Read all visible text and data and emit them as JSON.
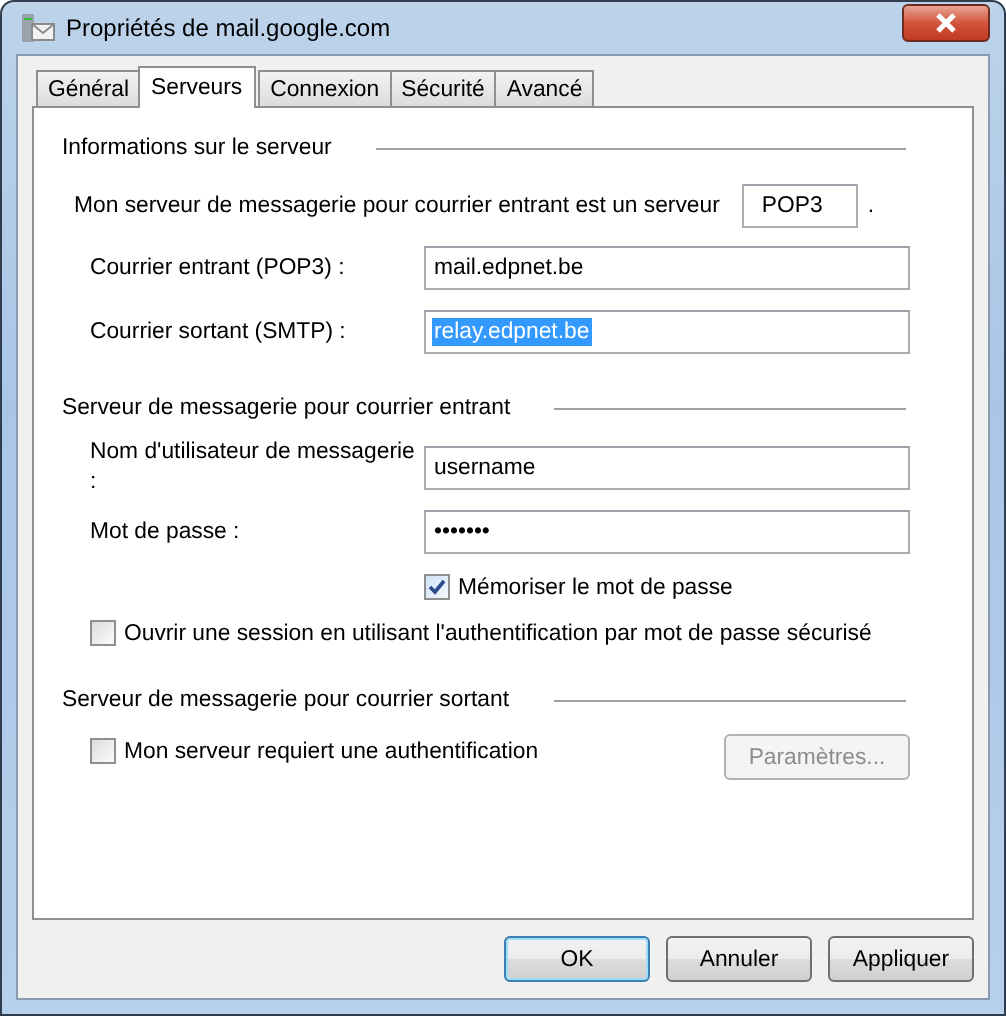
{
  "window": {
    "title": "Propriétés de mail.google.com"
  },
  "tabs": [
    {
      "label": "Général",
      "selected": false
    },
    {
      "label": "Serveurs",
      "selected": true
    },
    {
      "label": "Connexion",
      "selected": false
    },
    {
      "label": "Sécurité",
      "selected": false
    },
    {
      "label": "Avancé",
      "selected": false
    }
  ],
  "sections": [
    {
      "heading": "Informations sur le serveur",
      "rows": [
        {
          "kind": "inline",
          "label": "Mon serveur de messagerie pour courrier entrant est un serveur",
          "value": "POP3",
          "suffix": "."
        },
        {
          "kind": "field",
          "label": "Courrier entrant (POP3) :",
          "value": "mail.edpnet.be",
          "highlighted": false
        },
        {
          "kind": "field",
          "label": "Courrier sortant (SMTP) :",
          "value": "relay.edpnet.be",
          "highlighted": true
        }
      ]
    },
    {
      "heading": "Serveur de messagerie pour courrier entrant",
      "rows": [
        {
          "kind": "field",
          "label": "Nom d'utilisateur de messagerie :",
          "value": "username",
          "highlighted": false
        },
        {
          "kind": "password",
          "label": "Mot de passe :",
          "value": "•••••••"
        },
        {
          "kind": "aligned_checkbox",
          "label": "Mémoriser le mot de passe",
          "checked": true
        },
        {
          "kind": "checkbox",
          "label": "Ouvrir une session en utilisant l'authentification par mot de passe sécurisé",
          "checked": false
        }
      ]
    },
    {
      "heading": "Serveur de messagerie pour courrier sortant",
      "rows": [
        {
          "kind": "checkbox",
          "label": "Mon serveur requiert une authentification",
          "checked": false,
          "button": {
            "label": "Paramètres...",
            "disabled": true
          }
        }
      ]
    }
  ],
  "buttons": [
    {
      "label": "OK",
      "default": true
    },
    {
      "label": "Annuler",
      "default": false
    },
    {
      "label": "Appliquer",
      "default": false
    }
  ]
}
